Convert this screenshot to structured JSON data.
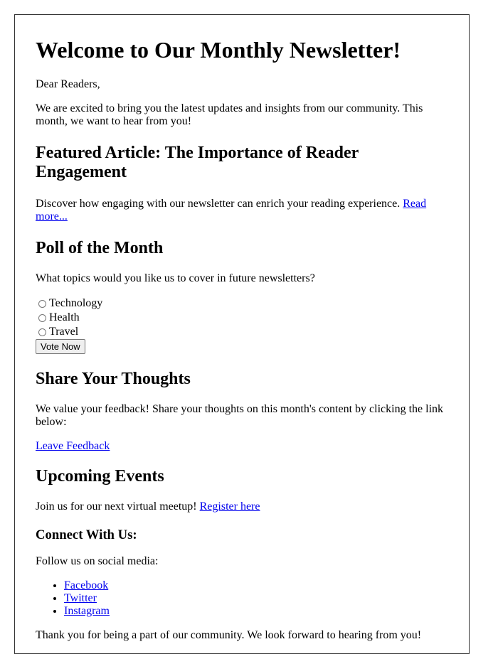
{
  "title": "Welcome to Our Monthly Newsletter!",
  "greeting": "Dear Readers,",
  "intro": "We are excited to bring you the latest updates and insights from our community. This month, we want to hear from you!",
  "featured": {
    "heading": "Featured Article: The Importance of Reader Engagement",
    "text": "Discover how engaging with our newsletter can enrich your reading experience. ",
    "link": "Read more..."
  },
  "poll": {
    "heading": "Poll of the Month",
    "question": "What topics would you like us to cover in future newsletters?",
    "options": [
      "Technology",
      "Health",
      "Travel"
    ],
    "button": "Vote Now"
  },
  "feedback": {
    "heading": "Share Your Thoughts",
    "text": "We value your feedback! Share your thoughts on this month's content by clicking the link below:",
    "link": "Leave Feedback"
  },
  "events": {
    "heading": "Upcoming Events",
    "text": "Join us for our next virtual meetup! ",
    "link": "Register here"
  },
  "connect": {
    "heading": "Connect With Us:",
    "text": "Follow us on social media:",
    "links": [
      "Facebook",
      "Twitter",
      "Instagram"
    ]
  },
  "closing": "Thank you for being a part of our community. We look forward to hearing from you!"
}
